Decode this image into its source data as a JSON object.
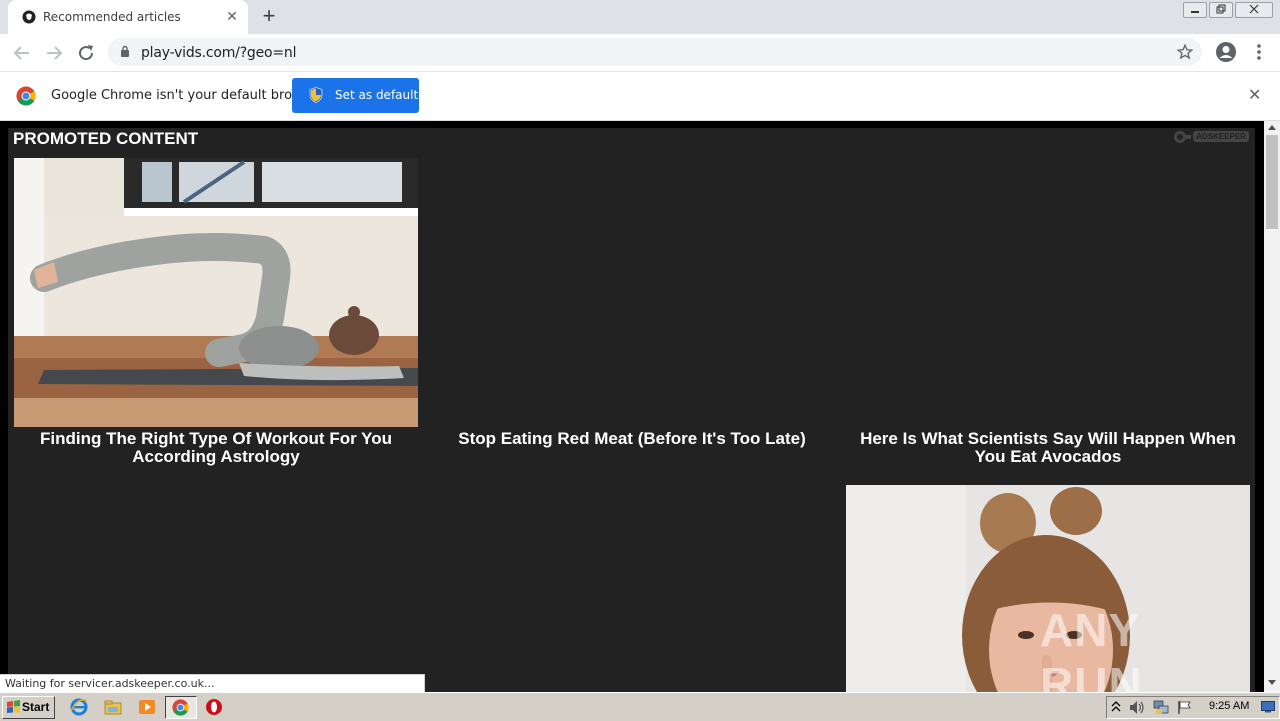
{
  "browser": {
    "tab_title": "Recommended articles",
    "url": "play-vids.com/?geo=nl",
    "infobar_message": "Google Chrome isn't your default browser",
    "set_default_label": "Set as default",
    "status_text": "Waiting for servicer.adskeeper.co.uk..."
  },
  "page": {
    "section_title": "PROMOTED CONTENT",
    "brand": "ADSKEEPER",
    "watermark": "ANY RUN",
    "articles": [
      {
        "title": "Finding The Right Type Of Workout For You According Astrology",
        "has_image": true,
        "image_alt": "woman stretching on yoga mat"
      },
      {
        "title": "Stop Eating Red Meat (Before It's Too Late)",
        "has_image": false
      },
      {
        "title": "Here Is What Scientists Say Will Happen When You Eat Avocados",
        "has_image": false
      },
      {
        "title": "",
        "has_image": false
      },
      {
        "title": "",
        "has_image": false
      },
      {
        "title": "",
        "has_image": true,
        "image_alt": "young woman with hair buns"
      }
    ]
  },
  "taskbar": {
    "start_label": "Start",
    "clock": "9:25 AM"
  },
  "colors": {
    "chrome_blue": "#1a73e8",
    "widget_bg": "#222222",
    "tabbar_bg": "#dee1e6",
    "taskbar_bg": "#d4d0c8"
  }
}
